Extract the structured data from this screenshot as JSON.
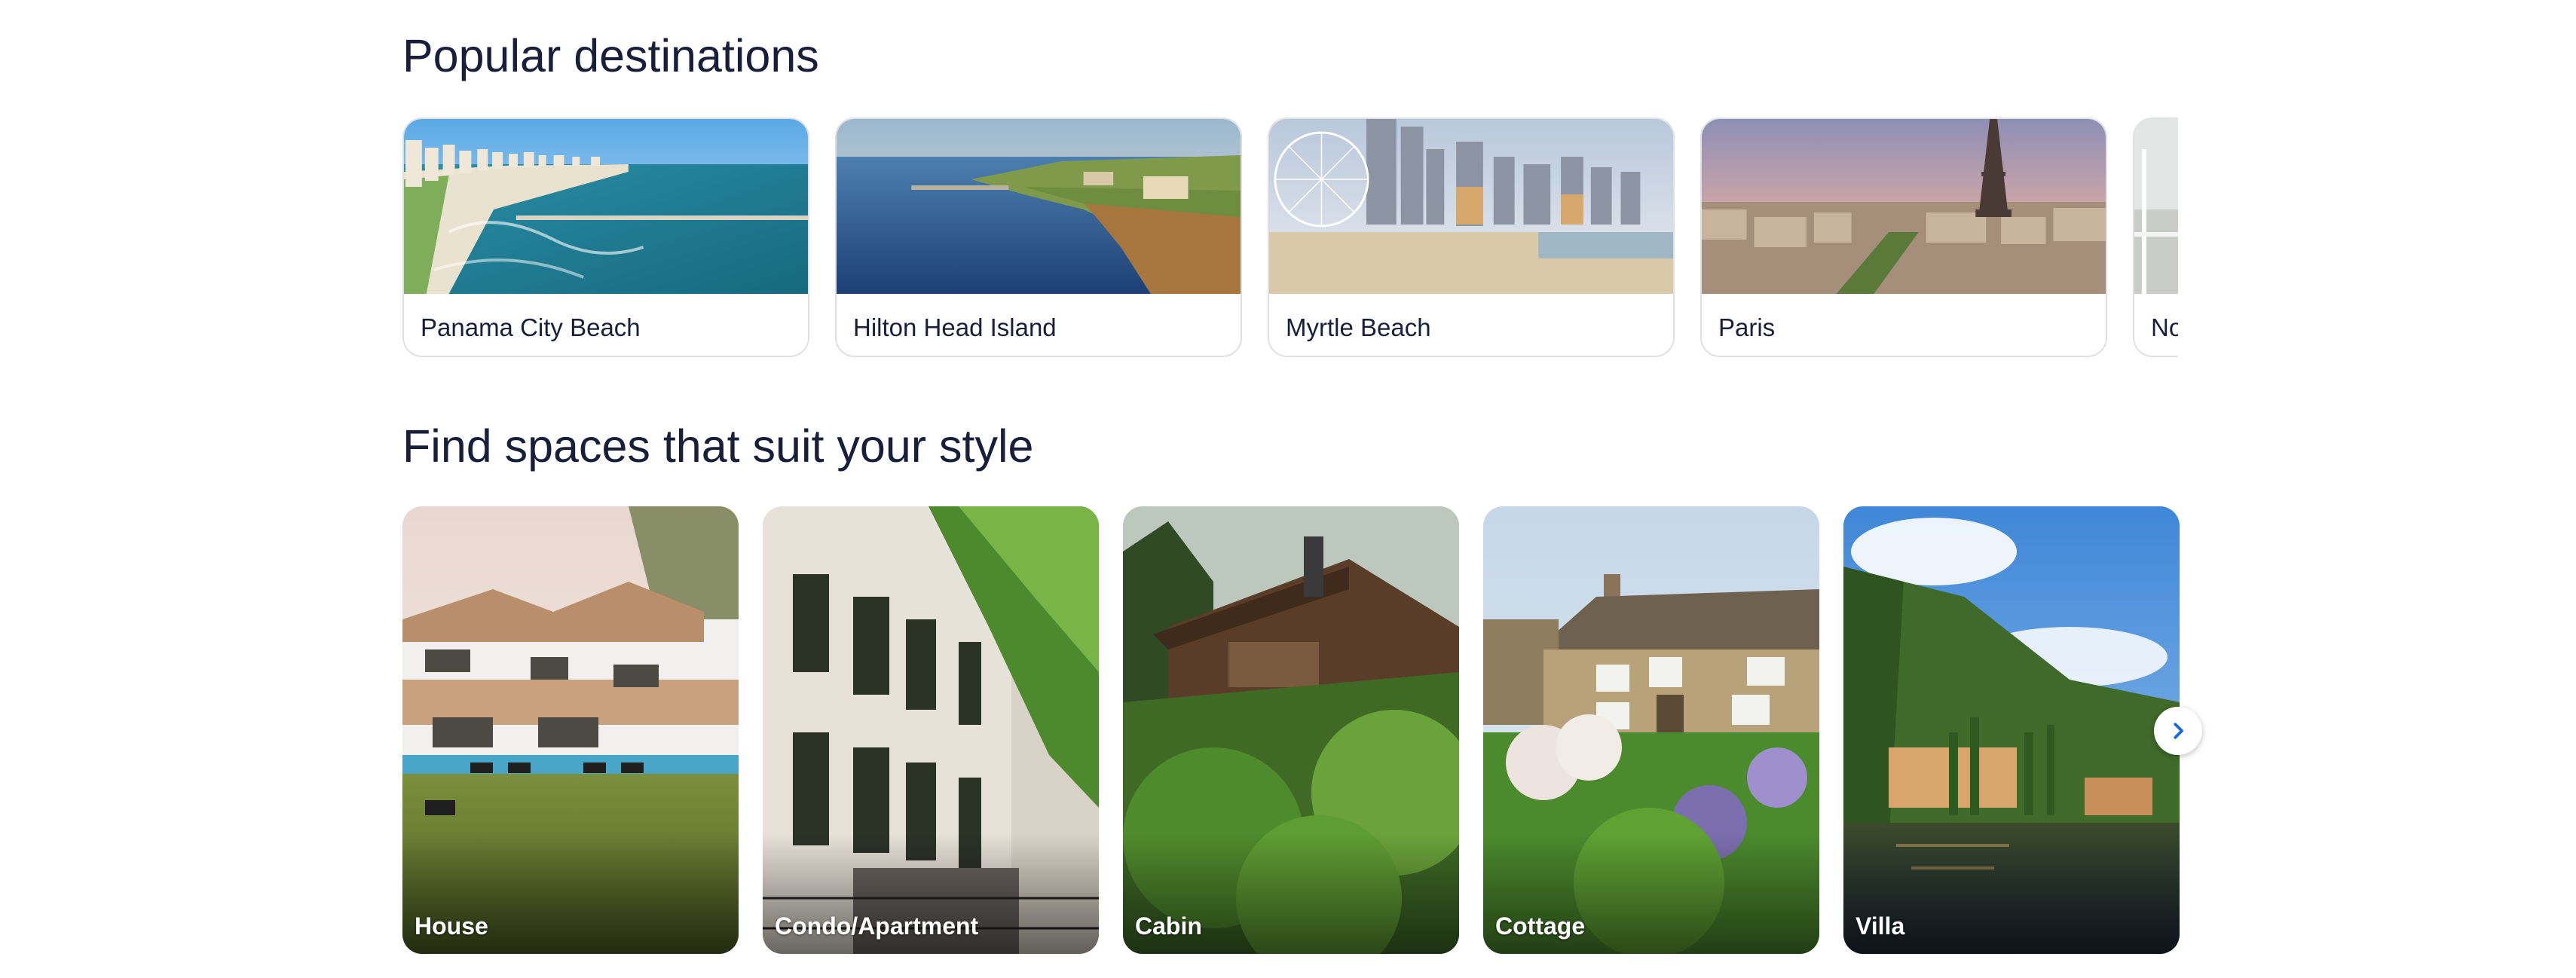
{
  "destinations": {
    "title": "Popular destinations",
    "items": [
      {
        "label": "Panama City Beach"
      },
      {
        "label": "Hilton Head Island"
      },
      {
        "label": "Myrtle Beach"
      },
      {
        "label": "Paris"
      },
      {
        "label": "No"
      }
    ]
  },
  "styles": {
    "title": "Find spaces that suit your style",
    "items": [
      {
        "label": "House"
      },
      {
        "label": "Condo/Apartment"
      },
      {
        "label": "Cabin"
      },
      {
        "label": "Cottage"
      },
      {
        "label": "Villa"
      }
    ],
    "next_icon": "chevron-right-icon"
  },
  "colors": {
    "heading": "#191e3b",
    "card_border": "#dfe0e4",
    "accent": "#1668e3"
  }
}
